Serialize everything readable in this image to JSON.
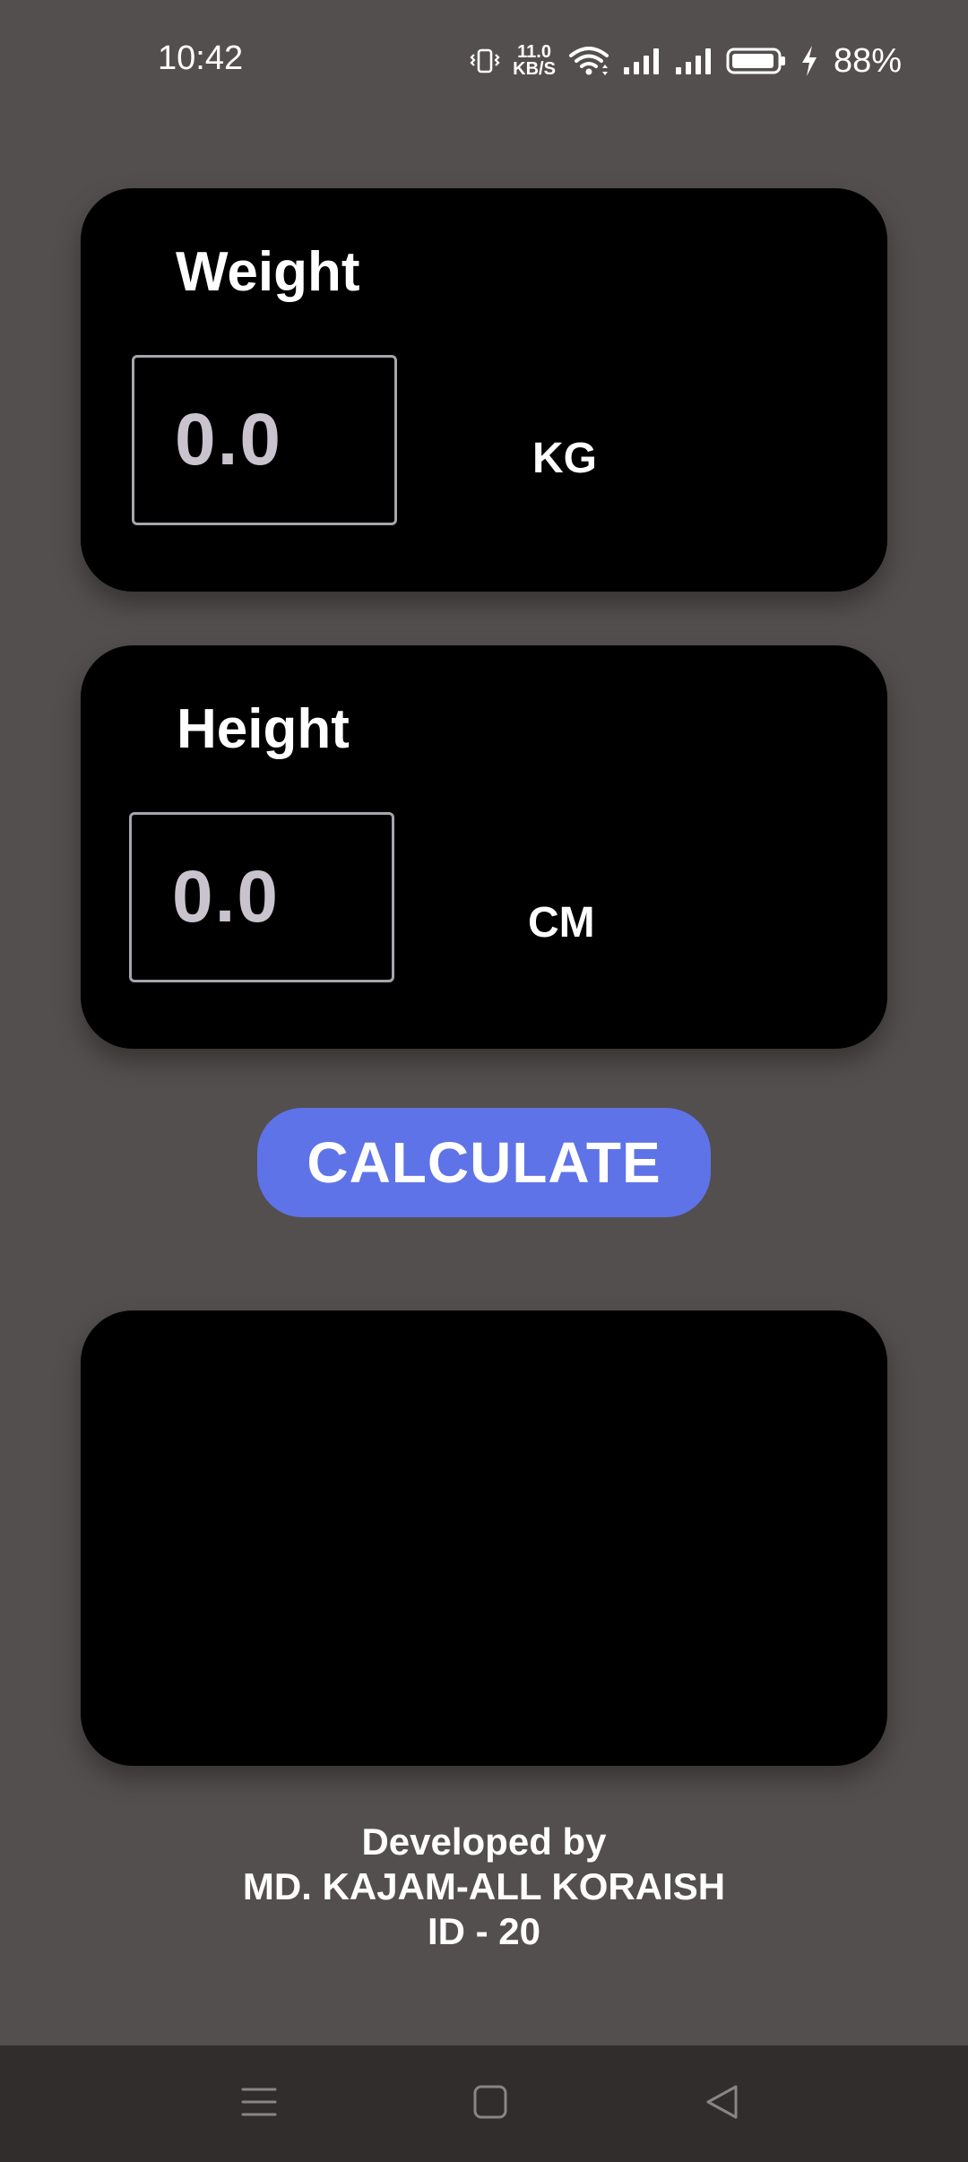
{
  "status_bar": {
    "time": "10:42",
    "net_speed_value": "11.0",
    "net_speed_unit": "KB/S",
    "battery_percent": "88%",
    "icons": [
      "vibrate-icon",
      "wifi-icon",
      "signal-icon",
      "signal-icon",
      "battery-icon",
      "charging-icon"
    ]
  },
  "weight_card": {
    "label": "Weight",
    "value": "0.0",
    "unit": "KG"
  },
  "height_card": {
    "label": "Height",
    "value": "0.0",
    "unit": "CM"
  },
  "calculate_button": {
    "label": "CALCULATE"
  },
  "result_card": {
    "text": ""
  },
  "credits": {
    "line1": "Developed by",
    "line2": "MD. KAJAM-ALL KORAISH",
    "line3": "ID - 20"
  },
  "nav_bar": {
    "icons": [
      "menu-icon",
      "home-icon",
      "back-icon"
    ]
  },
  "colors": {
    "background": "#544f4f",
    "card": "#000000",
    "accent_button": "#5f73e8",
    "input_border": "#a8a4ab",
    "input_text": "#c9c3cd",
    "nav_bar": "#322d2d"
  }
}
